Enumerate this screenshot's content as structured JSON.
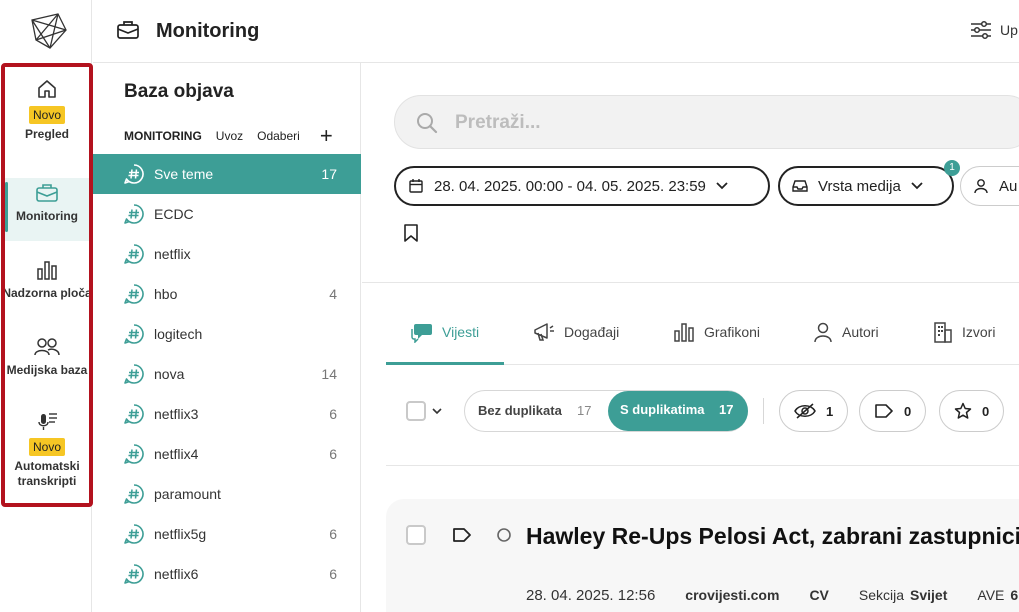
{
  "header": {
    "title": "Monitoring",
    "right_label": "Up"
  },
  "nav": {
    "items": [
      {
        "id": "pregled",
        "label": "Pregled",
        "badge": "Novo"
      },
      {
        "id": "monitoring",
        "label": "Monitoring"
      },
      {
        "id": "nadzorna",
        "label": "Nadzorna ploča"
      },
      {
        "id": "medijska",
        "label": "Medijska baza"
      },
      {
        "id": "transkripti",
        "label": "Automatski transkripti",
        "badge": "Novo"
      }
    ]
  },
  "topics": {
    "title": "Baza objava",
    "tabs": [
      "MONITORING",
      "Uvoz",
      "Odaberi"
    ],
    "list": [
      {
        "name": "Sve teme",
        "count": "17"
      },
      {
        "name": "ECDC",
        "count": ""
      },
      {
        "name": "netflix",
        "count": ""
      },
      {
        "name": "hbo",
        "count": "4"
      },
      {
        "name": "logitech",
        "count": ""
      },
      {
        "name": "nova",
        "count": "14"
      },
      {
        "name": "netflix3",
        "count": "6"
      },
      {
        "name": "netflix4",
        "count": "6"
      },
      {
        "name": "paramount",
        "count": ""
      },
      {
        "name": "netflix5g",
        "count": "6"
      },
      {
        "name": "netflix6",
        "count": "6"
      }
    ]
  },
  "search": {
    "placeholder": "Pretraži..."
  },
  "filters": {
    "date_range": "28. 04. 2025. 00:00 - 04. 05. 2025. 23:59",
    "media_type": "Vrsta medija",
    "media_type_badge": "1",
    "third": "Au"
  },
  "tabs": [
    {
      "label": "Vijesti"
    },
    {
      "label": "Događaji"
    },
    {
      "label": "Grafikoni"
    },
    {
      "label": "Autori"
    },
    {
      "label": "Izvori"
    }
  ],
  "toolbar": {
    "without_duplicates": "Bez duplikata",
    "without_duplicates_count": "17",
    "with_duplicates": "S duplikatima",
    "with_duplicates_count": "17",
    "hidden_count": "1",
    "tagged_count": "0",
    "starred_count": "0"
  },
  "article": {
    "title": "Hawley Re-Ups Pelosi Act, zabrani zastupnici",
    "date": "28. 04. 2025. 12:56",
    "source": "crovijesti.com",
    "country": "CV",
    "section_label": "Sekcija",
    "section_value": "Svijet",
    "ave_label": "AVE",
    "ave_value": "6"
  },
  "colors": {
    "accent": "#3d9e96",
    "highlight_border": "#b3121e",
    "badge": "#f6c624"
  }
}
